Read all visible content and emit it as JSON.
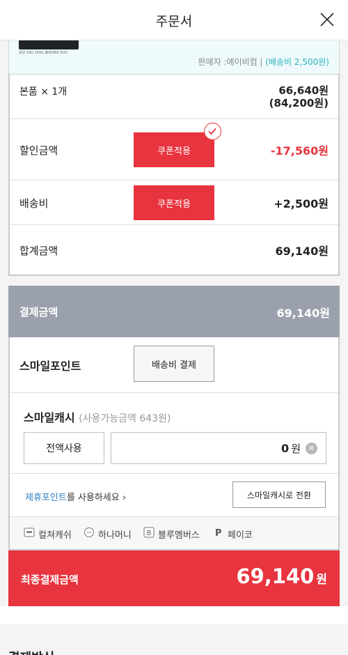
{
  "header": {
    "title": "주문서",
    "close_icon": "close-icon"
  },
  "product": {
    "thumb_label": "삼성 SSD 250G 블랙/860 EVO",
    "seller_prefix": "판매자 :에이비컴 | ",
    "shipping": "(배송비 2,500원)"
  },
  "summary": {
    "item_label": "본품 × 1개",
    "item_price": "66,640원",
    "item_original": "(84,200원)",
    "discount_label": "할인금액",
    "discount_coupon_btn": "쿠폰적용",
    "discount_value": "-17,560원",
    "shipping_label": "배송비",
    "shipping_coupon_btn": "쿠폰적용",
    "shipping_value": "+2,500원",
    "total_label": "합계금액",
    "total_value": "69,140원"
  },
  "payment": {
    "head_label": "결제금액",
    "head_value": "69,140원",
    "smile_point_label": "스마일포인트",
    "smile_point_btn": "배송비 결제",
    "smile_cash_title": "스마일캐시",
    "smile_cash_available": "(사용가능금액 643원)",
    "full_use_btn": "전액사용",
    "amount_value": "0",
    "amount_unit": "원",
    "partner_link_hl": "제휴포인트",
    "partner_link_rest": "를 사용하세요",
    "convert_btn": "스마일캐시로 전환",
    "partners": [
      {
        "name": "컬쳐캐쉬",
        "icon": "culture-cash-icon"
      },
      {
        "name": "하나머니",
        "icon": "hana-money-icon"
      },
      {
        "name": "블루멤버스",
        "icon": "blue-members-icon"
      },
      {
        "name": "페이코",
        "icon": "payco-icon"
      }
    ]
  },
  "final": {
    "label": "최종결제금액",
    "value": "69,140",
    "unit": "원"
  },
  "next_section_title": "결제방식",
  "colors": {
    "accent_red": "#e8343f",
    "pay_head_gray": "#9aa0ac",
    "link_blue": "#2f7fc1",
    "shipping_teal": "#2bb3be"
  }
}
